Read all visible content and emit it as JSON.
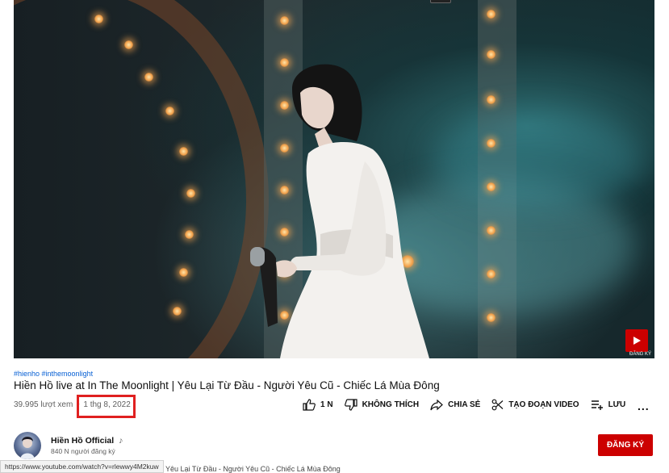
{
  "video": {
    "subscribe_badge_label": "ĐĂNG KÝ"
  },
  "hashtags": "#hienho #inthemoonlight",
  "title": "Hiền Hồ live at In The Moonlight | Yêu Lại Từ Đầu - Người Yêu Cũ - Chiếc Lá Mùa Đông",
  "views": "39.995 lượt xem",
  "separator": "•",
  "date": "1 thg 8, 2022",
  "actions": {
    "like_count": "1 N",
    "dislike_label": "KHÔNG THÍCH",
    "share_label": "CHIA SẺ",
    "clip_label": "TẠO ĐOẠN VIDEO",
    "save_label": "LƯU",
    "more_label": "..."
  },
  "channel": {
    "name": "Hiền Hồ Official",
    "verified_icon": "music-note-icon",
    "subscribers": "840 N người đăng ký",
    "subscribe_label": "ĐĂNG KÝ"
  },
  "status_bar_url": "https://www.youtube.com/watch?v=rlewwy4M2kuw",
  "description_peek": "Yêu Lại Từ Đầu - Người Yêu Cũ - Chiếc Lá Mùa Đông",
  "colors": {
    "accent_red": "#cc0000",
    "link_blue": "#065fd4",
    "highlight_box": "#e02020"
  }
}
